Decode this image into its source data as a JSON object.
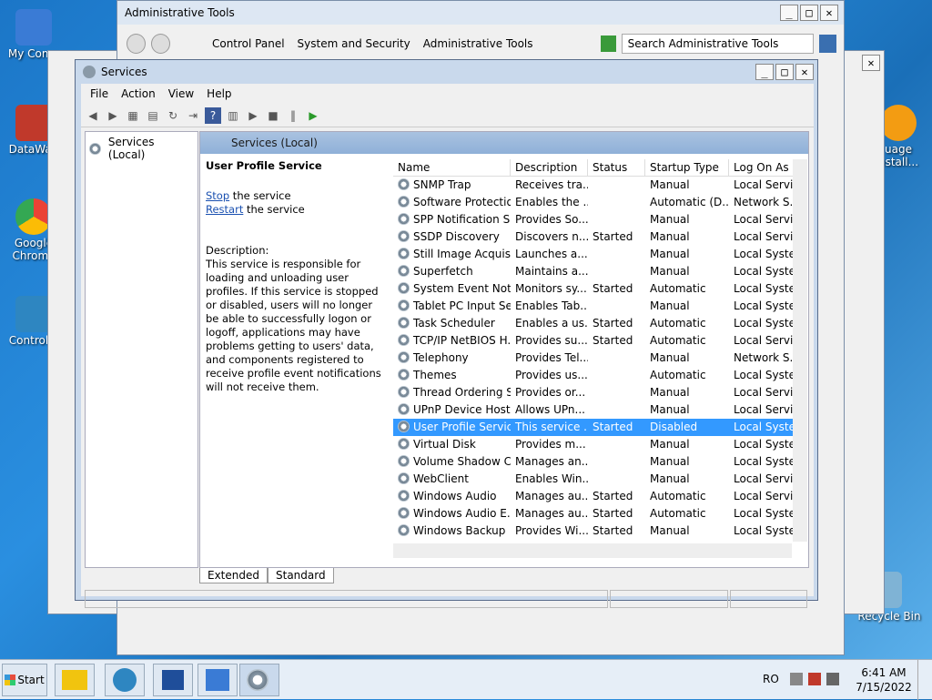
{
  "desktop": {
    "icons": [
      {
        "label": "My Comp",
        "color": "#3a7bd5"
      },
      {
        "label": "DataWag",
        "color": "#c0392b"
      },
      {
        "label": "Google Chrome",
        "color": "#34a853"
      },
      {
        "label": "Control P",
        "color": "#2e86c1"
      },
      {
        "label": "uage nstall...",
        "color": "#f39c12"
      },
      {
        "label": "Recycle Bin",
        "color": "#7fb3d5"
      }
    ]
  },
  "admin_tools": {
    "title": "Administrative Tools",
    "breadcrumb": [
      "Control Panel",
      "System and Security",
      "Administrative Tools"
    ],
    "search_placeholder": "Search Administrative Tools"
  },
  "services": {
    "title": "Services",
    "menu": [
      "File",
      "Action",
      "View",
      "Help"
    ],
    "tree_item": "Services (Local)",
    "pane_title": "Services (Local)",
    "selected_service": "User Profile Service",
    "stop_link": "Stop",
    "stop_text": " the service",
    "restart_link": "Restart",
    "restart_text": " the service",
    "description_label": "Description:",
    "description": "This service is responsible for loading and unloading user profiles. If this service is stopped or disabled, users will no longer be able to successfully logon or logoff, applications may have problems getting to users' data, and components registered to receive profile event notifications will not receive them.",
    "columns": [
      "Name",
      "Description",
      "Status",
      "Startup Type",
      "Log On As"
    ],
    "rows": [
      [
        "SNMP Trap",
        "Receives tra...",
        "",
        "Manual",
        "Local Servic"
      ],
      [
        "Software Protection",
        "Enables the ...",
        "",
        "Automatic (D...",
        "Network S..."
      ],
      [
        "SPP Notification S...",
        "Provides So...",
        "",
        "Manual",
        "Local Servic"
      ],
      [
        "SSDP Discovery",
        "Discovers n...",
        "Started",
        "Manual",
        "Local Servic"
      ],
      [
        "Still Image Acquisi...",
        "Launches a...",
        "",
        "Manual",
        "Local Syste."
      ],
      [
        "Superfetch",
        "Maintains a...",
        "",
        "Manual",
        "Local Syste."
      ],
      [
        "System Event Noti...",
        "Monitors sy...",
        "Started",
        "Automatic",
        "Local Syste."
      ],
      [
        "Tablet PC Input Se...",
        "Enables Tab...",
        "",
        "Manual",
        "Local Syste."
      ],
      [
        "Task Scheduler",
        "Enables a us...",
        "Started",
        "Automatic",
        "Local Syste."
      ],
      [
        "TCP/IP NetBIOS H...",
        "Provides su...",
        "Started",
        "Automatic",
        "Local Servic"
      ],
      [
        "Telephony",
        "Provides Tel...",
        "",
        "Manual",
        "Network S..."
      ],
      [
        "Themes",
        "Provides us...",
        "",
        "Automatic",
        "Local Syste."
      ],
      [
        "Thread Ordering S...",
        "Provides or...",
        "",
        "Manual",
        "Local Servic"
      ],
      [
        "UPnP Device Host",
        "Allows UPn...",
        "",
        "Manual",
        "Local Servic"
      ],
      [
        "User Profile Service",
        "This service ...",
        "Started",
        "Disabled",
        "Local Syste."
      ],
      [
        "Virtual Disk",
        "Provides m...",
        "",
        "Manual",
        "Local Syste."
      ],
      [
        "Volume Shadow C...",
        "Manages an...",
        "",
        "Manual",
        "Local Syste."
      ],
      [
        "WebClient",
        "Enables Win...",
        "",
        "Manual",
        "Local Servic"
      ],
      [
        "Windows Audio",
        "Manages au...",
        "Started",
        "Automatic",
        "Local Servic"
      ],
      [
        "Windows Audio E...",
        "Manages au...",
        "Started",
        "Automatic",
        "Local Syste."
      ],
      [
        "Windows Backup",
        "Provides Wi...",
        "Started",
        "Manual",
        "Local Syste."
      ]
    ],
    "tabs": [
      "Extended",
      "Standard"
    ]
  },
  "taskbar": {
    "start": "Start",
    "lang": "RO",
    "time": "6:41 AM",
    "date": "7/15/2022"
  }
}
